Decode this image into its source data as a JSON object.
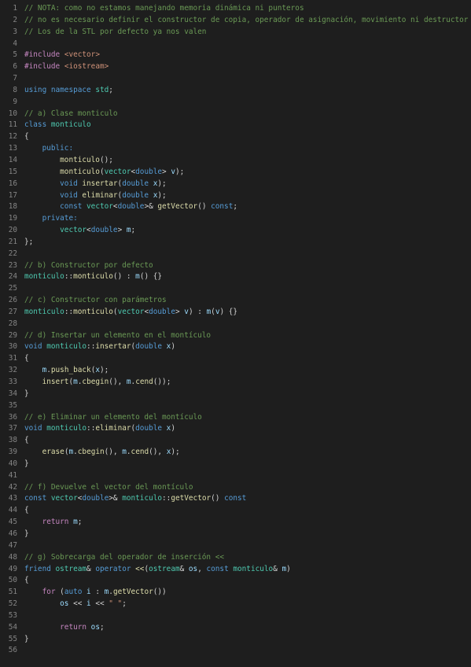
{
  "editor": {
    "language": "cpp",
    "colors": {
      "background": "#1e1e1e",
      "line_number": "#858585",
      "comment": "#6a9955",
      "keyword": "#569cd6",
      "control": "#c586c0",
      "type": "#4ec9b0",
      "function": "#dcdcaa",
      "variable": "#9cdcfe",
      "string": "#ce9178",
      "plain": "#d4d4d4"
    },
    "lines": [
      {
        "n": "1",
        "tokens": [
          [
            "cm",
            "// NOTA: como no estamos manejando memoria dinámica ni punteros"
          ]
        ]
      },
      {
        "n": "2",
        "tokens": [
          [
            "cm",
            "// no es necesario definir el constructor de copia, operador de asignación, movimiento ni destructor"
          ]
        ]
      },
      {
        "n": "3",
        "tokens": [
          [
            "cm",
            "// Los de la STL por defecto ya nos valen"
          ]
        ]
      },
      {
        "n": "4",
        "tokens": []
      },
      {
        "n": "5",
        "tokens": [
          [
            "inc",
            "#include "
          ],
          [
            "str",
            "<vector>"
          ]
        ]
      },
      {
        "n": "6",
        "tokens": [
          [
            "inc",
            "#include "
          ],
          [
            "str",
            "<iostream>"
          ]
        ]
      },
      {
        "n": "7",
        "tokens": []
      },
      {
        "n": "8",
        "tokens": [
          [
            "kw",
            "using namespace "
          ],
          [
            "ty",
            "std"
          ],
          [
            "pl",
            ";"
          ]
        ]
      },
      {
        "n": "9",
        "tokens": []
      },
      {
        "n": "10",
        "tokens": [
          [
            "cm",
            "// a) Clase monticulo"
          ]
        ]
      },
      {
        "n": "11",
        "tokens": [
          [
            "kw",
            "class "
          ],
          [
            "ty",
            "monticulo"
          ]
        ]
      },
      {
        "n": "12",
        "tokens": [
          [
            "pl",
            "{"
          ]
        ]
      },
      {
        "n": "13",
        "tokens": [
          [
            "pl",
            "    "
          ],
          [
            "kw",
            "public:"
          ]
        ]
      },
      {
        "n": "14",
        "tokens": [
          [
            "pl",
            "        "
          ],
          [
            "fn",
            "monticulo"
          ],
          [
            "pl",
            "();"
          ]
        ]
      },
      {
        "n": "15",
        "tokens": [
          [
            "pl",
            "        "
          ],
          [
            "fn",
            "monticulo"
          ],
          [
            "pl",
            "("
          ],
          [
            "ty",
            "vector"
          ],
          [
            "pl",
            "<"
          ],
          [
            "kw",
            "double"
          ],
          [
            "pl",
            "> "
          ],
          [
            "var",
            "v"
          ],
          [
            "pl",
            ");"
          ]
        ]
      },
      {
        "n": "16",
        "tokens": [
          [
            "pl",
            "        "
          ],
          [
            "kw",
            "void "
          ],
          [
            "fn",
            "insertar"
          ],
          [
            "pl",
            "("
          ],
          [
            "kw",
            "double "
          ],
          [
            "var",
            "x"
          ],
          [
            "pl",
            ");"
          ]
        ]
      },
      {
        "n": "17",
        "tokens": [
          [
            "pl",
            "        "
          ],
          [
            "kw",
            "void "
          ],
          [
            "fn",
            "eliminar"
          ],
          [
            "pl",
            "("
          ],
          [
            "kw",
            "double "
          ],
          [
            "var",
            "x"
          ],
          [
            "pl",
            ");"
          ]
        ]
      },
      {
        "n": "18",
        "tokens": [
          [
            "pl",
            "        "
          ],
          [
            "kw",
            "const "
          ],
          [
            "ty",
            "vector"
          ],
          [
            "pl",
            "<"
          ],
          [
            "kw",
            "double"
          ],
          [
            "pl",
            ">& "
          ],
          [
            "fn",
            "getVector"
          ],
          [
            "pl",
            "() "
          ],
          [
            "kw",
            "const"
          ],
          [
            "pl",
            ";"
          ]
        ]
      },
      {
        "n": "19",
        "tokens": [
          [
            "pl",
            "    "
          ],
          [
            "kw",
            "private:"
          ]
        ]
      },
      {
        "n": "20",
        "tokens": [
          [
            "pl",
            "        "
          ],
          [
            "ty",
            "vector"
          ],
          [
            "pl",
            "<"
          ],
          [
            "kw",
            "double"
          ],
          [
            "pl",
            "> "
          ],
          [
            "var",
            "m"
          ],
          [
            "pl",
            ";"
          ]
        ]
      },
      {
        "n": "21",
        "tokens": [
          [
            "pl",
            "};"
          ]
        ]
      },
      {
        "n": "22",
        "tokens": []
      },
      {
        "n": "23",
        "tokens": [
          [
            "cm",
            "// b) Constructor por defecto"
          ]
        ]
      },
      {
        "n": "24",
        "tokens": [
          [
            "ty",
            "monticulo"
          ],
          [
            "pl",
            "::"
          ],
          [
            "fn",
            "monticulo"
          ],
          [
            "pl",
            "() : "
          ],
          [
            "var",
            "m"
          ],
          [
            "pl",
            "() {}"
          ]
        ]
      },
      {
        "n": "25",
        "tokens": []
      },
      {
        "n": "26",
        "tokens": [
          [
            "cm",
            "// c) Constructor con parámetros"
          ]
        ]
      },
      {
        "n": "27",
        "tokens": [
          [
            "ty",
            "monticulo"
          ],
          [
            "pl",
            "::"
          ],
          [
            "fn",
            "monticulo"
          ],
          [
            "pl",
            "("
          ],
          [
            "ty",
            "vector"
          ],
          [
            "pl",
            "<"
          ],
          [
            "kw",
            "double"
          ],
          [
            "pl",
            "> "
          ],
          [
            "var",
            "v"
          ],
          [
            "pl",
            ") : "
          ],
          [
            "var",
            "m"
          ],
          [
            "pl",
            "("
          ],
          [
            "var",
            "v"
          ],
          [
            "pl",
            ") {}"
          ]
        ]
      },
      {
        "n": "28",
        "tokens": []
      },
      {
        "n": "29",
        "tokens": [
          [
            "cm",
            "// d) Insertar un elemento en el montículo"
          ]
        ]
      },
      {
        "n": "30",
        "tokens": [
          [
            "kw",
            "void "
          ],
          [
            "ty",
            "monticulo"
          ],
          [
            "pl",
            "::"
          ],
          [
            "fn",
            "insertar"
          ],
          [
            "pl",
            "("
          ],
          [
            "kw",
            "double "
          ],
          [
            "var",
            "x"
          ],
          [
            "pl",
            ")"
          ]
        ]
      },
      {
        "n": "31",
        "tokens": [
          [
            "pl",
            "{"
          ]
        ]
      },
      {
        "n": "32",
        "tokens": [
          [
            "pl",
            "    "
          ],
          [
            "var",
            "m"
          ],
          [
            "pl",
            "."
          ],
          [
            "fn",
            "push_back"
          ],
          [
            "pl",
            "("
          ],
          [
            "var",
            "x"
          ],
          [
            "pl",
            ");"
          ]
        ]
      },
      {
        "n": "33",
        "tokens": [
          [
            "pl",
            "    "
          ],
          [
            "fn",
            "insert"
          ],
          [
            "pl",
            "("
          ],
          [
            "var",
            "m"
          ],
          [
            "pl",
            "."
          ],
          [
            "fn",
            "cbegin"
          ],
          [
            "pl",
            "(), "
          ],
          [
            "var",
            "m"
          ],
          [
            "pl",
            "."
          ],
          [
            "fn",
            "cend"
          ],
          [
            "pl",
            "());"
          ]
        ]
      },
      {
        "n": "34",
        "tokens": [
          [
            "pl",
            "}"
          ]
        ]
      },
      {
        "n": "35",
        "tokens": []
      },
      {
        "n": "36",
        "tokens": [
          [
            "cm",
            "// e) Eliminar un elemento del montículo"
          ]
        ]
      },
      {
        "n": "37",
        "tokens": [
          [
            "kw",
            "void "
          ],
          [
            "ty",
            "monticulo"
          ],
          [
            "pl",
            "::"
          ],
          [
            "fn",
            "eliminar"
          ],
          [
            "pl",
            "("
          ],
          [
            "kw",
            "double "
          ],
          [
            "var",
            "x"
          ],
          [
            "pl",
            ")"
          ]
        ]
      },
      {
        "n": "38",
        "tokens": [
          [
            "pl",
            "{"
          ]
        ]
      },
      {
        "n": "39",
        "tokens": [
          [
            "pl",
            "    "
          ],
          [
            "fn",
            "erase"
          ],
          [
            "pl",
            "("
          ],
          [
            "var",
            "m"
          ],
          [
            "pl",
            "."
          ],
          [
            "fn",
            "cbegin"
          ],
          [
            "pl",
            "(), "
          ],
          [
            "var",
            "m"
          ],
          [
            "pl",
            "."
          ],
          [
            "fn",
            "cend"
          ],
          [
            "pl",
            "(), "
          ],
          [
            "var",
            "x"
          ],
          [
            "pl",
            ");"
          ]
        ]
      },
      {
        "n": "40",
        "tokens": [
          [
            "pl",
            "}"
          ]
        ]
      },
      {
        "n": "41",
        "tokens": []
      },
      {
        "n": "42",
        "tokens": [
          [
            "cm",
            "// f) Devuelve el vector del montículo"
          ]
        ]
      },
      {
        "n": "43",
        "tokens": [
          [
            "kw",
            "const "
          ],
          [
            "ty",
            "vector"
          ],
          [
            "pl",
            "<"
          ],
          [
            "kw",
            "double"
          ],
          [
            "pl",
            ">& "
          ],
          [
            "ty",
            "monticulo"
          ],
          [
            "pl",
            "::"
          ],
          [
            "fn",
            "getVector"
          ],
          [
            "pl",
            "() "
          ],
          [
            "kw",
            "const"
          ]
        ]
      },
      {
        "n": "44",
        "tokens": [
          [
            "pl",
            "{"
          ]
        ]
      },
      {
        "n": "45",
        "tokens": [
          [
            "pl",
            "    "
          ],
          [
            "ctl",
            "return "
          ],
          [
            "var",
            "m"
          ],
          [
            "pl",
            ";"
          ]
        ]
      },
      {
        "n": "46",
        "tokens": [
          [
            "pl",
            "}"
          ]
        ]
      },
      {
        "n": "47",
        "tokens": []
      },
      {
        "n": "48",
        "tokens": [
          [
            "cm",
            "// g) Sobrecarga del operador de inserción <<"
          ]
        ]
      },
      {
        "n": "49",
        "tokens": [
          [
            "kw",
            "friend "
          ],
          [
            "ty",
            "ostream"
          ],
          [
            "pl",
            "& "
          ],
          [
            "kw",
            "operator "
          ],
          [
            "fn",
            "<<"
          ],
          [
            "pl",
            "("
          ],
          [
            "ty",
            "ostream"
          ],
          [
            "pl",
            "& "
          ],
          [
            "var",
            "os"
          ],
          [
            "pl",
            ", "
          ],
          [
            "kw",
            "const "
          ],
          [
            "ty",
            "monticulo"
          ],
          [
            "pl",
            "& "
          ],
          [
            "var",
            "m"
          ],
          [
            "pl",
            ")"
          ]
        ]
      },
      {
        "n": "50",
        "tokens": [
          [
            "pl",
            "{"
          ]
        ]
      },
      {
        "n": "51",
        "tokens": [
          [
            "pl",
            "    "
          ],
          [
            "ctl",
            "for "
          ],
          [
            "pl",
            "("
          ],
          [
            "kw",
            "auto "
          ],
          [
            "var",
            "i"
          ],
          [
            "pl",
            " : "
          ],
          [
            "var",
            "m"
          ],
          [
            "pl",
            "."
          ],
          [
            "fn",
            "getVector"
          ],
          [
            "pl",
            "())"
          ]
        ]
      },
      {
        "n": "52",
        "tokens": [
          [
            "pl",
            "        "
          ],
          [
            "var",
            "os"
          ],
          [
            "pl",
            " << "
          ],
          [
            "var",
            "i"
          ],
          [
            "pl",
            " << "
          ],
          [
            "str",
            "\" \""
          ],
          [
            "pl",
            ";"
          ]
        ]
      },
      {
        "n": "53",
        "tokens": []
      },
      {
        "n": "54",
        "tokens": [
          [
            "pl",
            "        "
          ],
          [
            "ctl",
            "return "
          ],
          [
            "var",
            "os"
          ],
          [
            "pl",
            ";"
          ]
        ]
      },
      {
        "n": "55",
        "tokens": [
          [
            "pl",
            "}"
          ]
        ]
      },
      {
        "n": "56",
        "tokens": []
      }
    ]
  }
}
